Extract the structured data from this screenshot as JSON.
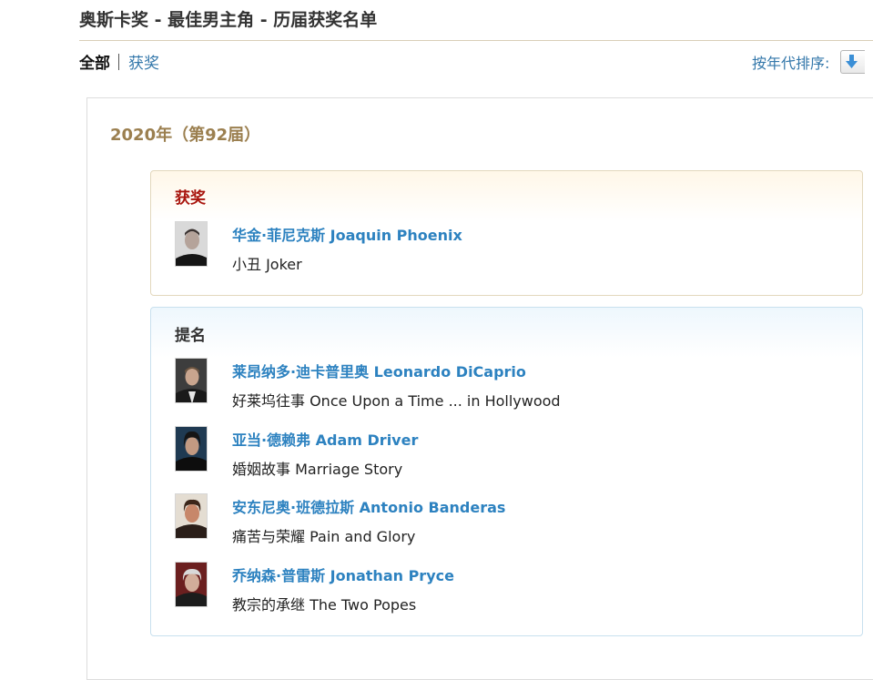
{
  "page": {
    "title": "奥斯卡奖 - 最佳男主角 - 历届获奖名单"
  },
  "filters": {
    "all_label": "全部",
    "won_label": "获奖"
  },
  "sort": {
    "label": "按年代排序:",
    "icon": "sort-down-arrow-icon"
  },
  "ceremony": {
    "heading": "2020年（第92届）",
    "winners": {
      "label": "获奖",
      "entries": [
        {
          "name": "华金·菲尼克斯 Joaquin Phoenix",
          "film": "小丑 Joker"
        }
      ]
    },
    "nominees": {
      "label": "提名",
      "entries": [
        {
          "name": "莱昂纳多·迪卡普里奥 Leonardo DiCaprio",
          "film": "好莱坞往事 Once Upon a Time ... in Hollywood"
        },
        {
          "name": "亚当·德赖弗 Adam Driver",
          "film": "婚姻故事 Marriage Story"
        },
        {
          "name": "安东尼奥·班德拉斯 Antonio Banderas",
          "film": "痛苦与荣耀 Pain and Glory"
        },
        {
          "name": "乔纳森·普雷斯 Jonathan Pryce",
          "film": "教宗的承继 The Two Popes"
        }
      ]
    }
  },
  "colors": {
    "link": "#2d82c0",
    "winner_label": "#a8140d",
    "year_heading": "#9b7f4f"
  }
}
